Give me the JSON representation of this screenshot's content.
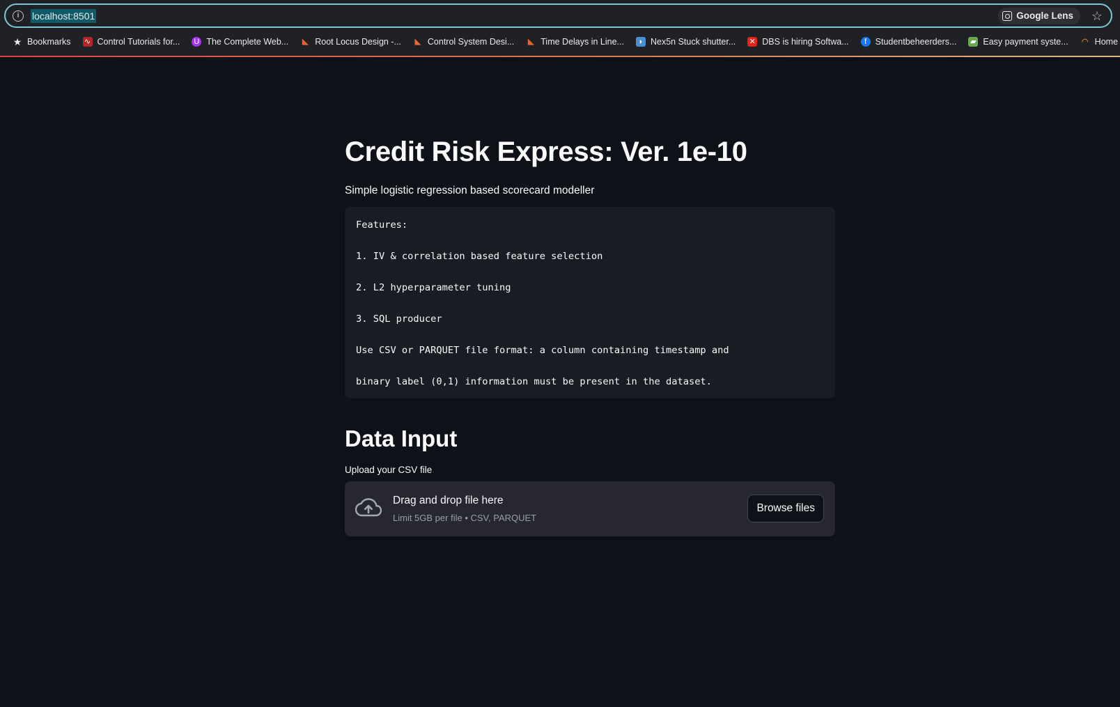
{
  "browser": {
    "url": "localhost:8501",
    "lens_label": "Google Lens",
    "bookmarks": [
      {
        "label": "Bookmarks",
        "icon": "star-icon",
        "color": "#e8eaed"
      },
      {
        "label": "Control Tutorials for...",
        "icon": "waveform-icon",
        "color": "#b3262c"
      },
      {
        "label": "The Complete Web...",
        "icon": "udemy-icon",
        "color": "#a435f0"
      },
      {
        "label": "Root Locus Design -...",
        "icon": "matlab-icon",
        "color": "#e16737"
      },
      {
        "label": "Control System Desi...",
        "icon": "matlab-icon",
        "color": "#e16737"
      },
      {
        "label": "Time Delays in Line...",
        "icon": "matlab-icon",
        "color": "#e16737"
      },
      {
        "label": "Nex5n Stuck shutter...",
        "icon": "site-icon",
        "color": "#4a8fd1"
      },
      {
        "label": "DBS is hiring Softwa...",
        "icon": "dbs-icon",
        "color": "#e2231a"
      },
      {
        "label": "Studentbeheerders...",
        "icon": "facebook-icon",
        "color": "#1877f2"
      },
      {
        "label": "Easy payment syste...",
        "icon": "payment-icon",
        "color": "#6aa84f"
      },
      {
        "label": "Home",
        "icon": "home-icon",
        "color": "#e8710a"
      }
    ]
  },
  "app": {
    "title": "Credit Risk Express: Ver. 1e-10",
    "subtitle": "Simple logistic regression based scorecard modeller",
    "code_lines": [
      "Features:",
      "1. IV & correlation based feature selection",
      "2. L2 hyperparameter tuning",
      "3. SQL producer",
      "Use CSV or PARQUET file format: a column containing timestamp and",
      "binary label (0,1) information must be present in the dataset."
    ],
    "section_heading": "Data Input",
    "uploader": {
      "label": "Upload your CSV file",
      "drop_text": "Drag and drop file here",
      "limit_text": "Limit 5GB per file • CSV, PARQUET",
      "browse_label": "Browse files"
    }
  },
  "colors": {
    "background": "#0e1117",
    "code_background": "#1a1c24",
    "dropzone_background": "#262730",
    "accent": "#ff4b4b"
  }
}
